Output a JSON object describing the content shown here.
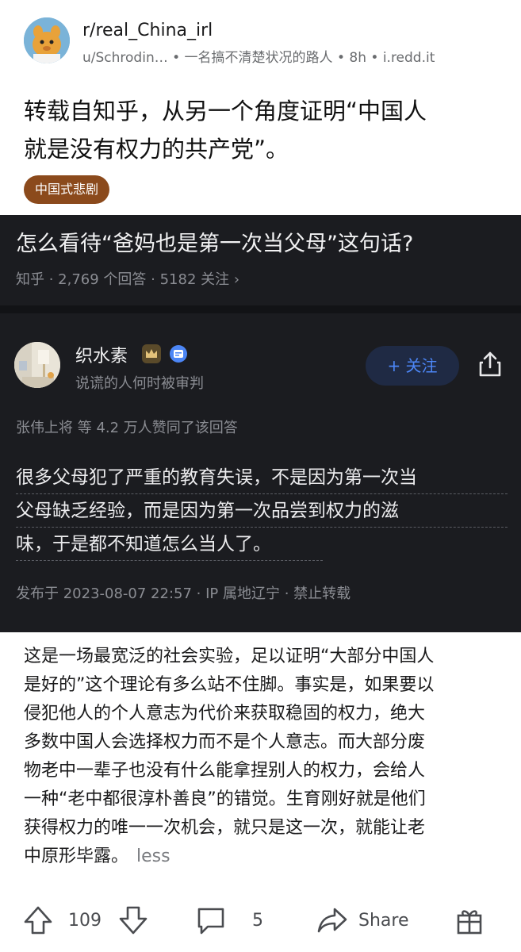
{
  "header": {
    "subreddit": "r/real_China_irl",
    "meta": "u/Schrodin… • 一名搞不清楚状况的路人 • 8h • i.redd.it"
  },
  "post": {
    "title_lines": [
      "转载自知乎，从另一个角度证明“中国人",
      "就是没有权力的共产党”。"
    ],
    "flair": "中国式悲剧",
    "flair_color": "#8b4a1c"
  },
  "screenshot": {
    "question": "怎么看待“爸妈也是第一次当父母”这句话?",
    "stats": "知乎 · 2,769 个回答 · 5182 关注 ›",
    "author_name": "织水素",
    "author_bio": "说谎的人何时被审判",
    "follow_label": "+ 关注",
    "likes": "张伟上将 等 4.2 万人赞同了该回答",
    "answer_lines": [
      "很多父母犯了严重的教育失误，不是因为第一次当",
      "父母缺乏经验，而是因为第一次品尝到权力的滋",
      "味，于是都不知道怎么当人了。"
    ],
    "published": "发布于 2023-08-07 22:57 · IP 属地辽宁 · 禁止转载",
    "bg_color": "#1b1c20",
    "accent": "#4c86f6"
  },
  "body": {
    "lines": [
      "这是一场最宽泛的社会实验，足以证明“大部分中国人",
      "是好的”这个理论有多么站不住脚。事实是，如果要以",
      "侵犯他人的个人意志为代价来获取稳固的权力，绝大",
      "多数中国人会选择权力而不是个人意志。而大部分废",
      "物老中一辈子也没有什么能拿捏别人的权力，会给人",
      "一种“老中都很淳朴善良”的错觉。生育刚好就是他们",
      "获得权力的唯一一次机会，就只是这一次，就能让老",
      "中原形毕露。"
    ],
    "less_label": "less"
  },
  "actions": {
    "upvotes": "109",
    "comments": "5",
    "share_label": "Share"
  },
  "icons": [
    "upvote-icon",
    "downvote-icon",
    "comment-icon",
    "share-icon",
    "award-icon",
    "chevron-right-icon",
    "crown-badge-icon",
    "verified-icon"
  ]
}
